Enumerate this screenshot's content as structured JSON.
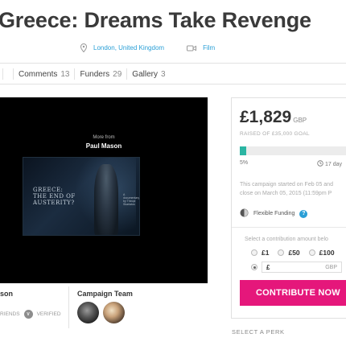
{
  "campaign": {
    "title": "Greece: Dreams Take Revenge",
    "location": "London, United Kingdom",
    "category": "Film"
  },
  "tabs": [
    {
      "label": "",
      "count": ""
    },
    {
      "label": "Comments",
      "count": "13"
    },
    {
      "label": "Funders",
      "count": "29"
    },
    {
      "label": "Gallery",
      "count": "3"
    }
  ],
  "video": {
    "more_from": "More from",
    "author": "Paul Mason",
    "caption_lines": [
      "GREECE:",
      "THE END OF",
      "AUSTERITY?"
    ],
    "doc_text": [
      "A documentary",
      "by Theopi Skarlatos"
    ]
  },
  "owner": {
    "name_fragment": "son",
    "friends_fragment": "RIENDS",
    "verified": "VERIFIED",
    "verified_icon": "V"
  },
  "team": {
    "title": "Campaign Team"
  },
  "funding": {
    "amount": "£1,829",
    "currency": "GBP",
    "goal_text": "RAISED OF £35,000 GOAL",
    "progress_percent": 5,
    "percent_label": "5%",
    "days_left": "17 day",
    "started_line1": "This campaign started on Feb 05 and",
    "started_line2": "close on March 05, 2015 (11:59pm P",
    "flex_label": "Flexible Funding",
    "flex_help": "?",
    "select_prompt": "Select a contribution amount belo",
    "options": [
      "£1",
      "£50",
      "£100"
    ],
    "custom_symbol": "£",
    "custom_currency": "GBP",
    "contribute_label": "CONTRIBUTE NOW",
    "perk_label": "SELECT A PERK"
  },
  "colors": {
    "accent": "#2a9fd6",
    "progress": "#2bb5a3",
    "cta": "#e5177b"
  }
}
